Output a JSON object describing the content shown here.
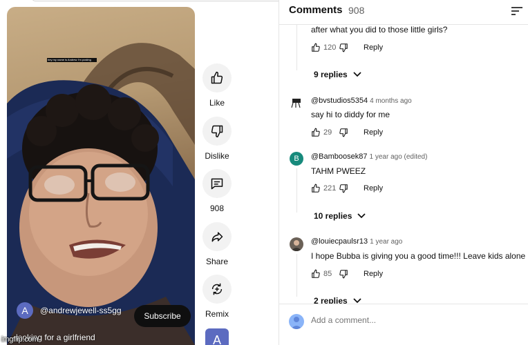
{
  "video": {
    "overlay_caption": "hey my name is Andrew I'm posting",
    "channel_avatar_letter": "A",
    "channel_name": "@andrewjewell-ss5gg",
    "subscribe_label": "Subscribe",
    "title": "looking for a girlfriend"
  },
  "actions": {
    "like_label": "Like",
    "dislike_label": "Dislike",
    "comments_count": "908",
    "share_label": "Share",
    "remix_label": "Remix",
    "bottom_avatar_letter": "A"
  },
  "comments_panel": {
    "title": "Comments",
    "count": "908",
    "add_placeholder": "Add a comment...",
    "comments": [
      {
        "author": "",
        "time": "",
        "text": "after what you did to those little girls?",
        "likes": "120",
        "reply_label": "Reply",
        "replies_label": "9 replies"
      },
      {
        "author": "@bvstudios5354",
        "time": "4 months ago",
        "text": "say hi to diddy for me",
        "likes": "29",
        "reply_label": "Reply",
        "replies_label": ""
      },
      {
        "author": "@Bamboosek87",
        "avatar_letter": "B",
        "time": "1 year ago (edited)",
        "text": "TAHM PWEEZ",
        "likes": "221",
        "reply_label": "Reply",
        "replies_label": "10 replies"
      },
      {
        "author": "@louiecpaulsr13",
        "time": "1 year ago",
        "text": "I hope Bubba is giving you a good time!!! Leave kids alone",
        "likes": "85",
        "reply_label": "Reply",
        "replies_label": "2 replies"
      }
    ]
  },
  "watermark": "imgflip.com"
}
